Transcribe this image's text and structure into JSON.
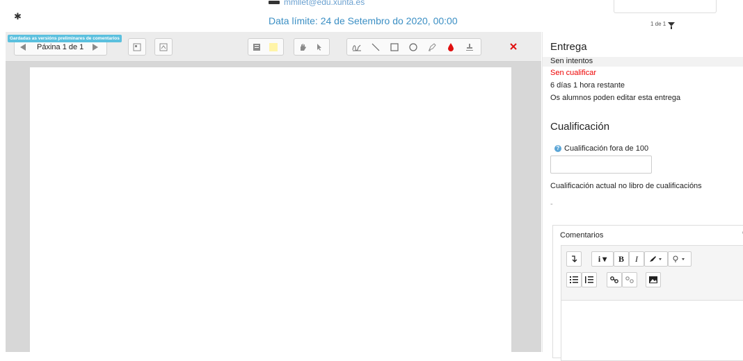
{
  "header": {
    "email_partial": "mmllet@edu.xunta.es",
    "deadline": "Data límite: 24 de Setembro do 2020, 00:00",
    "pager": "1 de 1"
  },
  "toolbar": {
    "page_label": "Páxina 1 de 1"
  },
  "saved_badge": "Gardadas as versións preliminares de comentarios",
  "side": {
    "submission_title": "Entrega",
    "attempts": "Sen intentos",
    "grade_status": "Sen cualificar",
    "time_remaining": "6 días 1 hora restante",
    "editable": "Os alumnos poden editar esta entrega",
    "grade_title": "Cualificación",
    "grade_out_of": "Cualificación fora de 100",
    "grade_value": "",
    "current_grade_label": "Cualificación actual no libro de cualificacións",
    "current_grade_value": "-",
    "comments_title": "Comentarios"
  },
  "colors": {
    "link_blue": "#3b8fc4",
    "badge": "#5bc0de",
    "status_red": "#e00000",
    "pen_red": "#e01010",
    "delete_red": "#e01010"
  }
}
